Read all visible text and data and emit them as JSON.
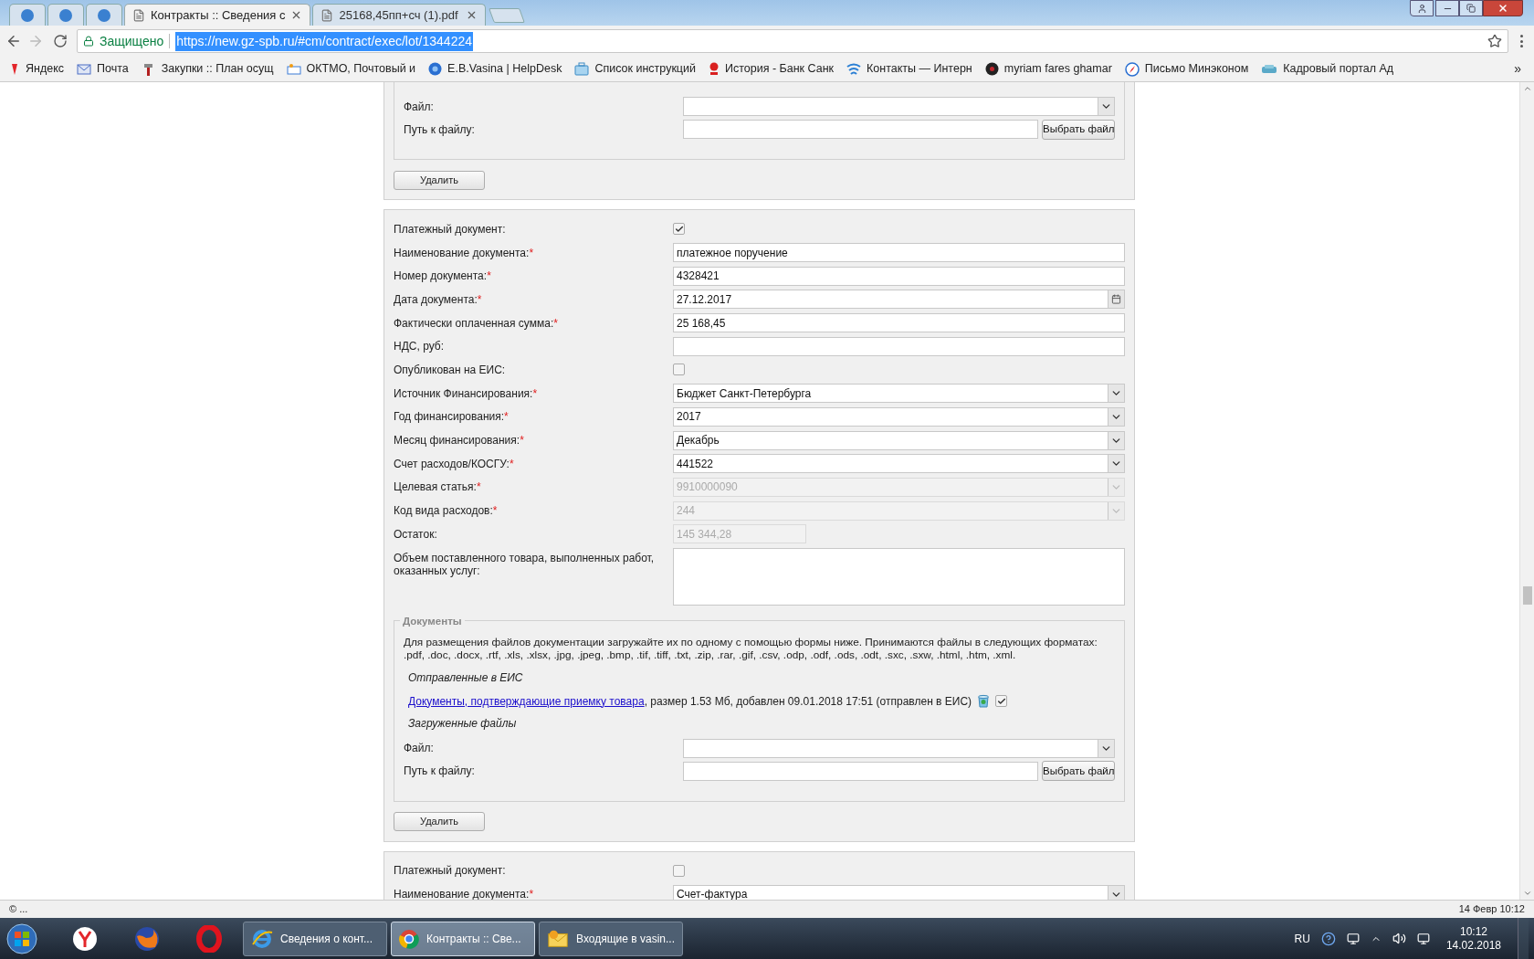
{
  "browser": {
    "tabs": [
      {
        "kind": "icon",
        "selected": false
      },
      {
        "kind": "icon",
        "selected": false
      },
      {
        "kind": "icon",
        "selected": false
      },
      {
        "kind": "page",
        "title": "Контракты :: Сведения с",
        "selected": true
      },
      {
        "kind": "page",
        "title": "25168,45пп+сч (1).pdf",
        "selected": false
      }
    ],
    "address": {
      "secure_label": "Защищено",
      "url": "https://new.gz-spb.ru/#cm/contract/exec/lot/1344224"
    },
    "bookmarks": [
      "Яндекс",
      "Почта",
      "Закупки :: План осущ",
      "ОКТМО, Почтовый и",
      "E.B.Vasina | HelpDesk",
      "Список инструкций",
      "История - Банк Санк",
      "Контакты — Интерн",
      "myriam fares ghamar",
      "Письмо Минэконом",
      "Кадровый портал Ад"
    ],
    "more": "»"
  },
  "sections": [
    {
      "kind": "tail",
      "files": {
        "file_label": "Файл:",
        "path_label": "Путь к файлу:",
        "choose_button": "Выбрать файл"
      },
      "delete_button": "Удалить"
    },
    {
      "kind": "payment",
      "rows": [
        {
          "kind": "checkbox",
          "label": "Платежный документ:",
          "checked": true
        },
        {
          "kind": "text",
          "label": "Наименование документа:",
          "mark": "*",
          "value": "платежное поручение"
        },
        {
          "kind": "text",
          "label": "Номер документа:",
          "mark": "*",
          "value": "4328421"
        },
        {
          "kind": "date",
          "label": "Дата документа:",
          "mark": "*",
          "value": "27.12.2017"
        },
        {
          "kind": "text",
          "label": "Фактически оплаченная сумма:",
          "mark": "*",
          "value": "25 168,45"
        },
        {
          "kind": "text",
          "label": "НДС, руб:"
        },
        {
          "kind": "checkbox",
          "label": "Опубликован на ЕИС:",
          "checked": false
        },
        {
          "kind": "select",
          "label": "Источник Финансирования:",
          "mark": "*",
          "value": "Бюджет Санкт-Петербурга",
          "disabled": false
        },
        {
          "kind": "select",
          "label": "Год финансирования:",
          "mark": "*",
          "value": "2017",
          "disabled": false
        },
        {
          "kind": "select",
          "label": "Месяц финансирования:",
          "mark": "*",
          "value": "Декабрь",
          "disabled": false
        },
        {
          "kind": "select",
          "label": "Счет расходов/КОСГУ:",
          "mark": "*",
          "value": "441522",
          "disabled": false
        },
        {
          "kind": "select",
          "label": "Целевая статья:",
          "mark": "*",
          "value": "9910000090",
          "disabled": true
        },
        {
          "kind": "select",
          "label": "Код вида расходов:",
          "mark": "*",
          "value": "244",
          "disabled": true
        },
        {
          "kind": "short",
          "label": "Остаток:",
          "value": "145 344,28",
          "disabled": true
        },
        {
          "kind": "textarea",
          "label": "Объем поставленного товара, выполненных работ, оказанных услуг:"
        }
      ],
      "documents": {
        "legend": "Документы",
        "note": "Для размещения файлов документации загружайте их по одному с помощью формы ниже. Принимаются файлы в следующих форматах: .pdf, .doc, .docx, .rtf, .xls, .xlsx, .jpg, .jpeg, .bmp, .tif, .tiff, .txt, .zip, .rar, .gif, .csv, .odp, .odf, .ods, .odt, .sxc, .sxw, .html, .htm, .xml.",
        "sent_heading": "Отправленные в ЕИС",
        "sent_files": [
          {
            "link": "Документы, подтверждающие приемку товара",
            "details": ", размер 1.53 Мб, добавлен 09.01.2018 17:51 (отправлен в ЕИС)",
            "checked": true
          }
        ],
        "uploaded_heading": "Загруженные файлы",
        "file_label": "Файл:",
        "path_label": "Путь к файлу:",
        "choose_button": "Выбрать файл"
      },
      "delete_button": "Удалить"
    },
    {
      "kind": "payment",
      "rows": [
        {
          "kind": "checkbox",
          "label": "Платежный документ:",
          "checked": false
        },
        {
          "kind": "select",
          "label": "Наименование документа:",
          "mark": "*",
          "value": "Счет-фактура",
          "disabled": false
        }
      ]
    }
  ],
  "status_bar": {
    "left": "© ...",
    "right": "14 Февр 10:12"
  },
  "taskbar": {
    "windows": [
      {
        "label": "Сведения о конт...",
        "selected": false
      },
      {
        "label": "Контракты :: Све...",
        "selected": true
      },
      {
        "label": "Входящие в vasin...",
        "selected": false
      }
    ],
    "language": "RU",
    "time": "10:12",
    "date": "14.02.2018"
  }
}
